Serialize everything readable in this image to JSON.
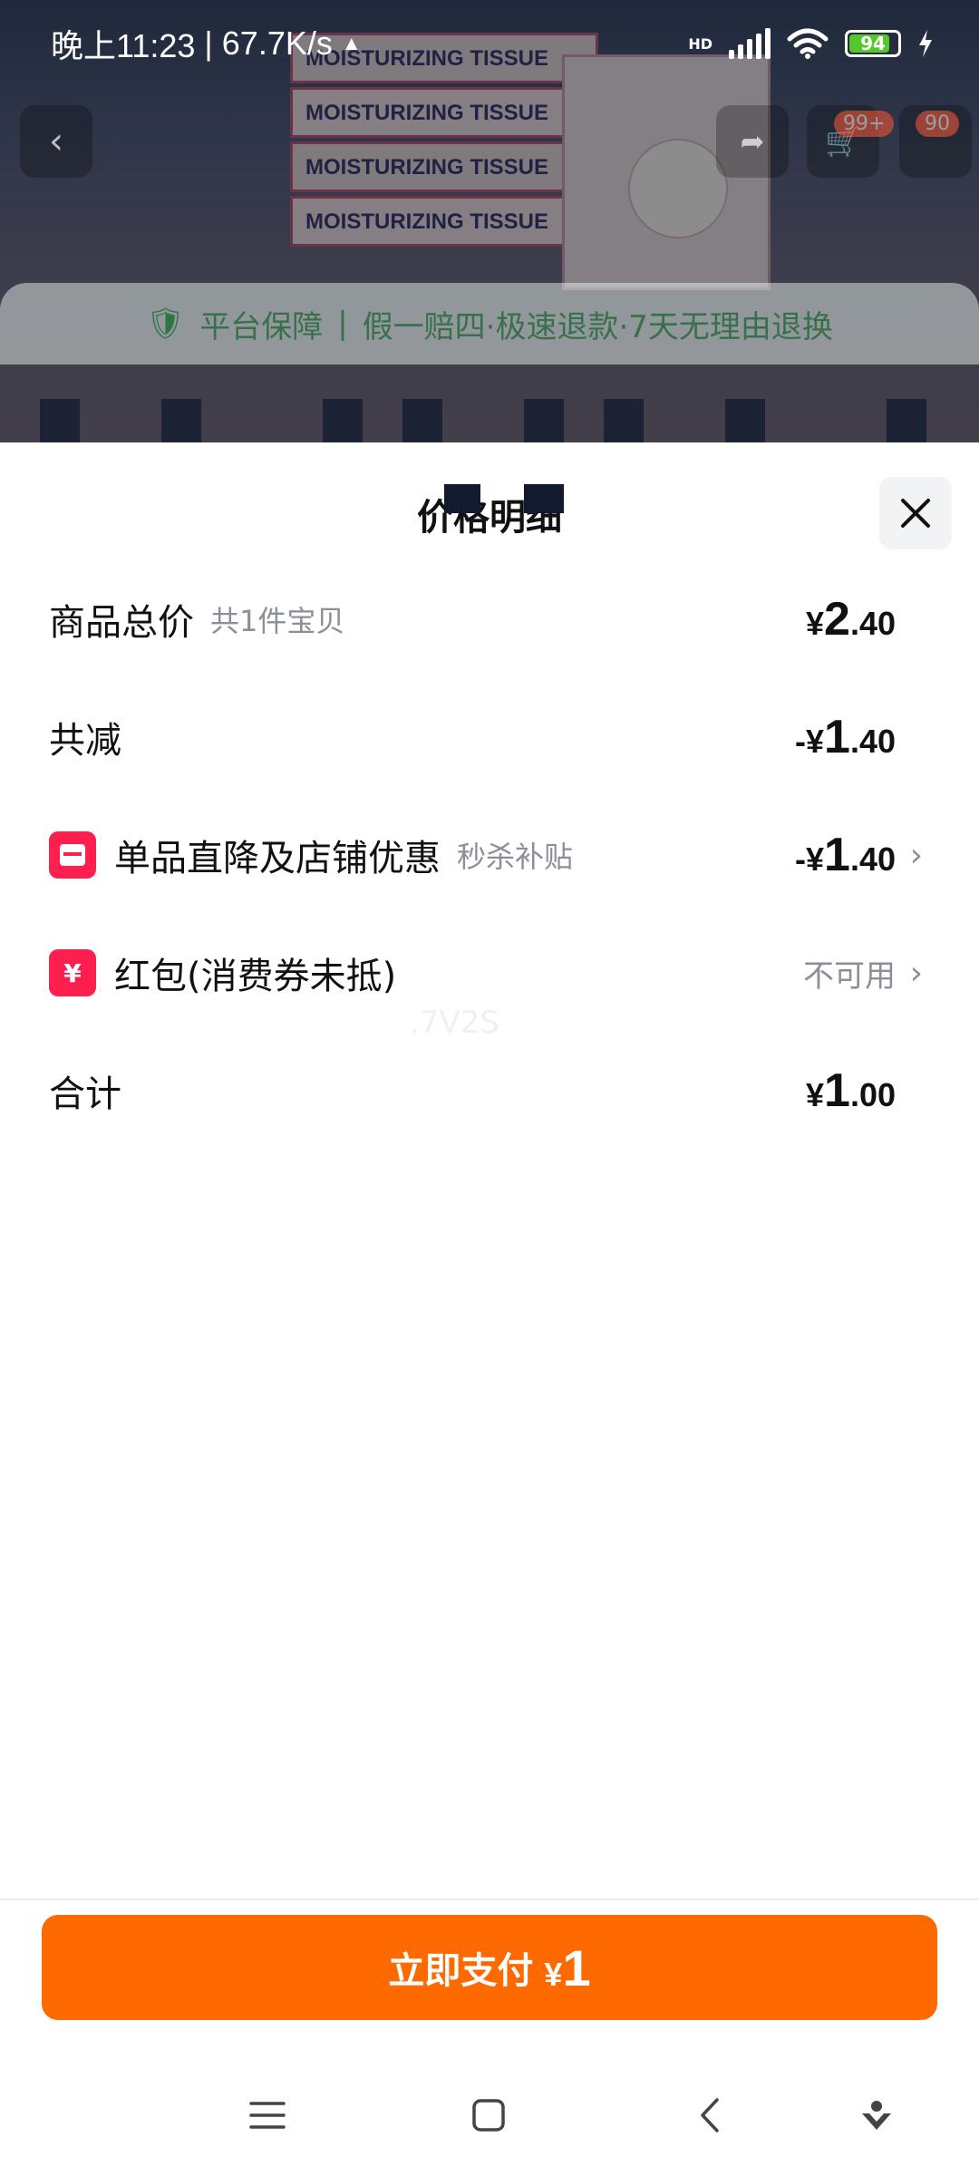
{
  "status_bar": {
    "time": "晚上11:23",
    "speed": "67.7K/s",
    "network": "HD",
    "battery": "94"
  },
  "background": {
    "box_text": "MOISTURIZING TISSUE",
    "cart_badge": "99+",
    "other_badge": "90",
    "guarantee_label": "平台保障",
    "guarantee_text": "假一赔四·极速退款·7天无理由退换"
  },
  "sheet": {
    "title": "价格明细",
    "rows": [
      {
        "label": "商品总价",
        "sub": "共1件宝贝",
        "value_prefix": "¥",
        "value_int": "2",
        "value_dec": ".40"
      },
      {
        "label": "共减",
        "value_prefix": "-¥",
        "value_int": "1",
        "value_dec": ".40"
      },
      {
        "label": "单品直降及店铺优惠",
        "sub": "秒杀补贴",
        "value_prefix": "-¥",
        "value_int": "1",
        "value_dec": ".40"
      },
      {
        "label": "红包(消费券未抵)",
        "status": "不可用"
      },
      {
        "label": "合计",
        "value_prefix": "¥",
        "value_int": "1",
        "value_dec": ".00"
      }
    ],
    "watermark": ".7V2S"
  },
  "pay_button": {
    "label": "立即支付",
    "currency": "¥",
    "amount": "1"
  },
  "colors": {
    "accent": "#ff6a00",
    "coupon_icon": "#ff1f4e"
  }
}
